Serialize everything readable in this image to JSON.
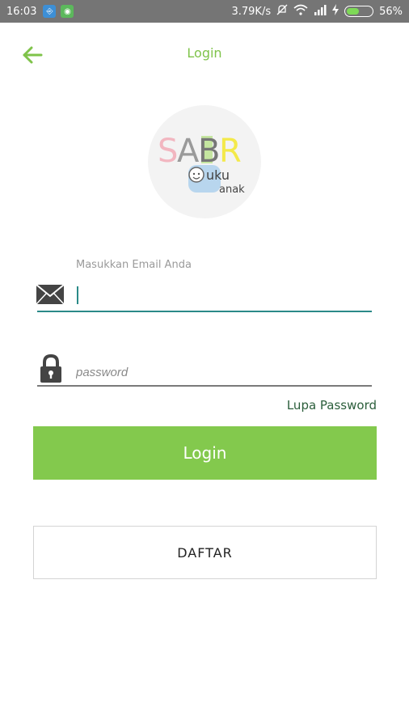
{
  "status_bar": {
    "time": "16:03",
    "network_speed": "3.79K/s",
    "battery_percent": "56%",
    "battery_level": 0.56,
    "icons": [
      "usb-icon",
      "android-icon",
      "mute-icon",
      "wifi-icon",
      "signal-icon",
      "charging-icon",
      "battery-icon"
    ]
  },
  "toolbar": {
    "title": "Login",
    "back_icon": "arrow-left-icon"
  },
  "logo": {
    "text_main": "SABR",
    "text_sub1": "uku",
    "text_sub2": "anak"
  },
  "form": {
    "email_label": "Masukkan Email Anda",
    "email_value": "",
    "email_icon": "mail-icon",
    "password_placeholder": "password",
    "password_value": "",
    "password_icon": "lock-icon",
    "forgot_password": "Lupa Password"
  },
  "buttons": {
    "login": "Login",
    "register": "DAFTAR"
  },
  "colors": {
    "accent_green": "#83c94d",
    "title_green": "#7fc34a",
    "input_focus": "#2a8a88",
    "status_bar": "#757575"
  }
}
